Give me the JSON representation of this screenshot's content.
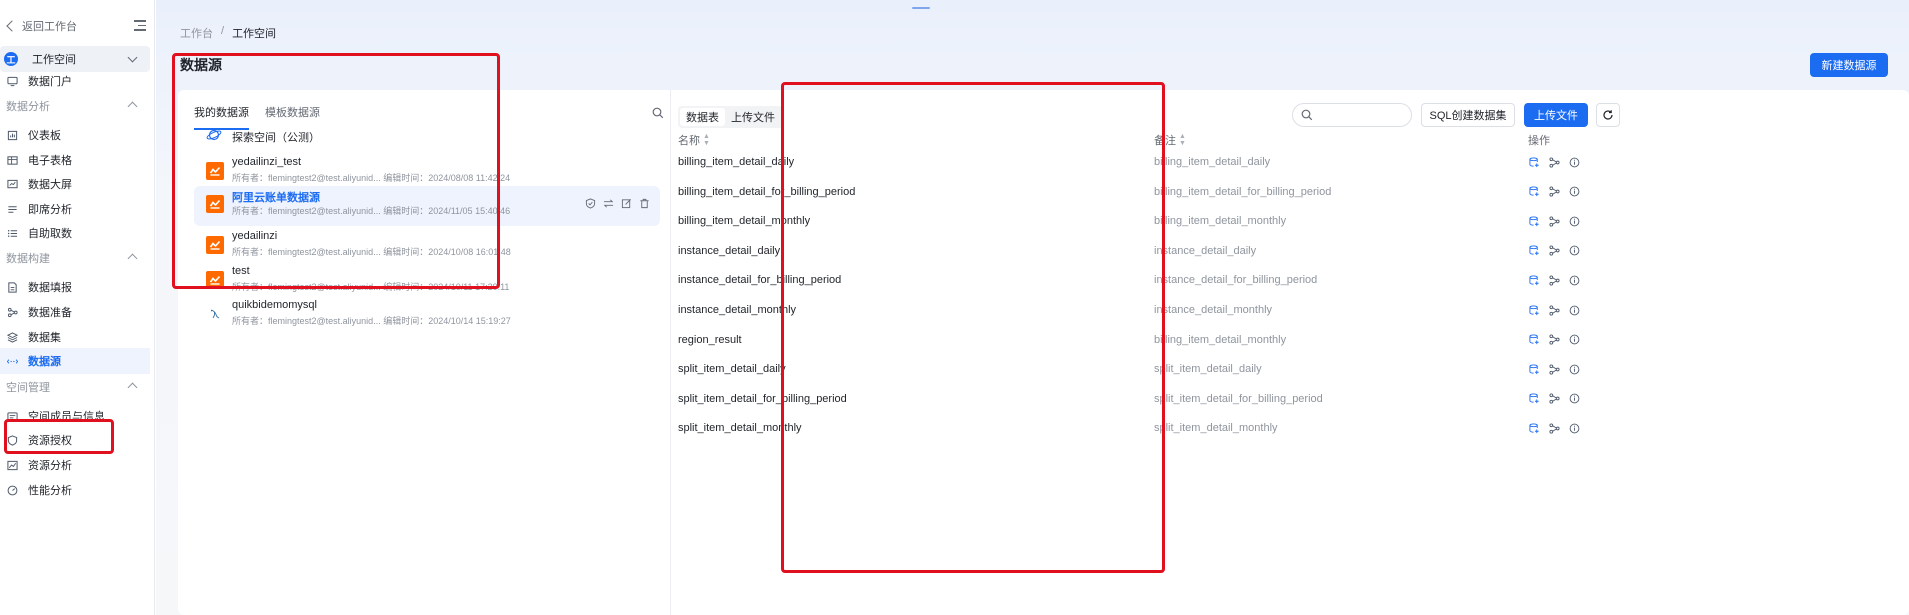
{
  "sidebar": {
    "back_label": "返回工作台",
    "workspace": {
      "badge": "工",
      "label": "工作空间"
    },
    "items": [
      {
        "label": "数据门户",
        "icon": "monitor-icon"
      },
      {
        "group": "数据分析"
      },
      {
        "label": "仪表板",
        "icon": "dashboard-icon"
      },
      {
        "label": "电子表格",
        "icon": "table-icon"
      },
      {
        "label": "数据大屏",
        "icon": "screen-icon"
      },
      {
        "label": "即席分析",
        "icon": "analysis-icon"
      },
      {
        "label": "自助取数",
        "icon": "fetch-icon"
      },
      {
        "group": "数据构建"
      },
      {
        "label": "数据填报",
        "icon": "form-icon"
      },
      {
        "label": "数据准备",
        "icon": "prepare-icon"
      },
      {
        "label": "数据集",
        "icon": "dataset-icon"
      },
      {
        "label": "数据源",
        "icon": "datasource-icon",
        "active": true
      },
      {
        "group": "空间管理"
      },
      {
        "label": "空间成员与信息",
        "icon": "members-icon"
      },
      {
        "label": "资源授权",
        "icon": "shield-icon"
      },
      {
        "label": "资源分析",
        "icon": "chart-icon"
      },
      {
        "label": "性能分析",
        "icon": "gauge-icon"
      }
    ]
  },
  "breadcrumb": {
    "root": "工作台",
    "sep": "/",
    "current": "工作空间"
  },
  "page_title": "数据源",
  "new_source_button": "新建数据源",
  "left_panel": {
    "tabs": [
      "我的数据源",
      "模板数据源"
    ],
    "explore": "探索空间（公测）",
    "sources": [
      {
        "name": "yedailinzi_test",
        "meta": "所有者：flemingtest2@test.aliyunid... 编辑时间：2024/08/08 11:42:24",
        "logo": "aliyun-logo"
      },
      {
        "name": "阿里云账单数据源",
        "meta": "所有者：flemingtest2@test.aliyunid... 编辑时间：2024/11/05 15:40:46",
        "logo": "aliyun-logo",
        "selected": true
      },
      {
        "name": "yedailinzi",
        "meta": "所有者：flemingtest2@test.aliyunid... 编辑时间：2024/10/08 16:01:48",
        "logo": "aliyun-logo"
      },
      {
        "name": "test",
        "meta": "所有者：flemingtest2@test.aliyunid... 编辑时间：2024/10/11 17:29:11",
        "logo": "aliyun-logo"
      },
      {
        "name": "quikbidemomysql",
        "meta": "所有者：flemingtest2@test.aliyunid... 编辑时间：2024/10/14 15:19:27",
        "logo": "mysql-logo"
      }
    ]
  },
  "right_panel": {
    "tabs": [
      "数据表",
      "上传文件"
    ],
    "search_placeholder": "",
    "sql_button": "SQL创建数据集",
    "upload_button": "上传文件",
    "columns": {
      "name": "名称",
      "remark": "备注",
      "ops": "操作"
    },
    "rows": [
      {
        "name": "billing_item_detail_daily",
        "remark": "billing_item_detail_daily"
      },
      {
        "name": "billing_item_detail_for_billing_period",
        "remark": "billing_item_detail_for_billing_period"
      },
      {
        "name": "billing_item_detail_monthly",
        "remark": "billing_item_detail_monthly"
      },
      {
        "name": "instance_detail_daily",
        "remark": "instance_detail_daily"
      },
      {
        "name": "instance_detail_for_billing_period",
        "remark": "instance_detail_for_billing_period"
      },
      {
        "name": "instance_detail_monthly",
        "remark": "instance_detail_monthly"
      },
      {
        "name": "region_result",
        "remark": "billing_item_detail_monthly"
      },
      {
        "name": "split_item_detail_daily",
        "remark": "split_item_detail_daily"
      },
      {
        "name": "split_item_detail_for_billing_period",
        "remark": "split_item_detail_for_billing_period"
      },
      {
        "name": "split_item_detail_monthly",
        "remark": "split_item_detail_monthly"
      }
    ]
  },
  "colors": {
    "accent": "#1c6cf2",
    "highlight": "#e0101f",
    "aliyun": "#ff6a00"
  }
}
